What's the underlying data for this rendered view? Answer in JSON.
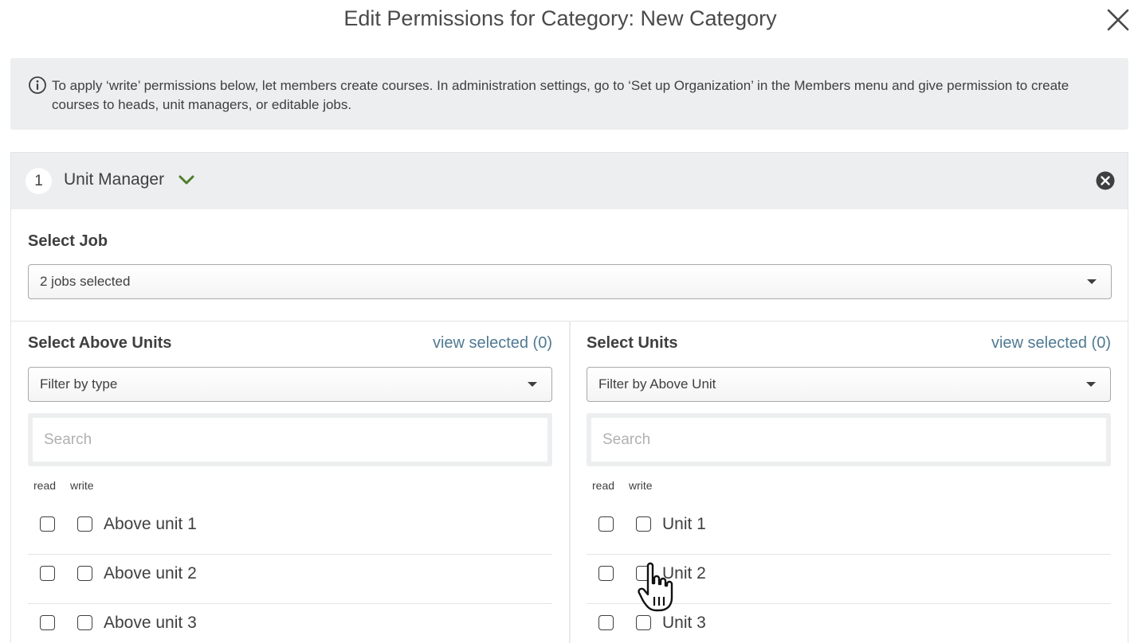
{
  "dialog": {
    "title": "Edit Permissions for Category: New Category",
    "close_icon": "close-x-icon"
  },
  "info": {
    "icon": "info-circle-icon",
    "text": "To apply ‘write’ permissions below, let members create courses. In administration settings, go to ‘Set up Organization’ in the Members menu and give permission to create courses to heads, unit managers, or editable jobs."
  },
  "permission_group": {
    "number": "1",
    "role": "Unit Manager",
    "expand_icon": "chevron-down-icon",
    "remove_icon": "remove-circle-icon",
    "accent_color": "#4e7d2a",
    "select_job": {
      "label": "Select Job",
      "value": "2 jobs selected"
    },
    "above_units": {
      "title": "Select Above Units",
      "view_selected": "view selected (0)",
      "filter": "Filter by type",
      "search_placeholder": "Search",
      "read_label": "read",
      "write_label": "write",
      "items": [
        {
          "label": "Above unit 1",
          "read": false,
          "write": false
        },
        {
          "label": "Above unit 2",
          "read": false,
          "write": false
        },
        {
          "label": "Above unit 3",
          "read": false,
          "write": false
        }
      ]
    },
    "units": {
      "title": "Select Units",
      "view_selected": "view selected (0)",
      "filter": "Filter by Above Unit",
      "search_placeholder": "Search",
      "read_label": "read",
      "write_label": "write",
      "items": [
        {
          "label": "Unit 1",
          "read": false,
          "write": false
        },
        {
          "label": "Unit 2",
          "read": false,
          "write": false
        },
        {
          "label": "Unit 3",
          "read": false,
          "write": false
        }
      ]
    }
  },
  "link_color": "#4f7a92"
}
